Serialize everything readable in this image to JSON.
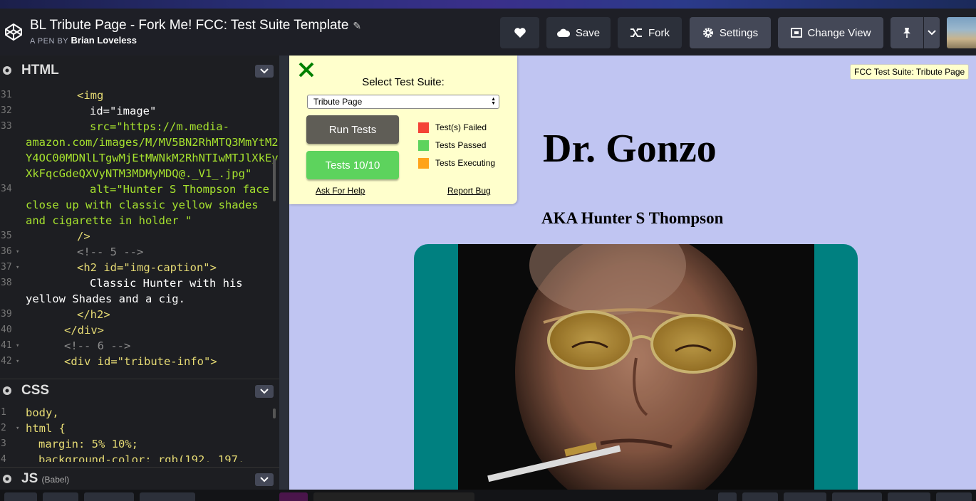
{
  "header": {
    "title": "BL Tribute Page - Fork Me! FCC: Test Suite Template",
    "byline_prefix": "A PEN BY",
    "author": "Brian Loveless",
    "buttons": {
      "save": "Save",
      "fork": "Fork",
      "settings": "Settings",
      "change_view": "Change View"
    }
  },
  "editor": {
    "html_label": "HTML",
    "css_label": "CSS",
    "js_label": "JS",
    "js_sub": "(Babel)",
    "html_lines": [
      {
        "n": "31",
        "text": "<img"
      },
      {
        "n": "32",
        "text": "id=\"image\""
      },
      {
        "n": "33",
        "text": "src=\"https://m.media-"
      },
      {
        "n": "",
        "text": "amazon.com/images/M/MV5BN2RhMTQ3MmYtM2"
      },
      {
        "n": "",
        "text": "Y4OC00MDNlLTgwMjEtMWNkM2RhNTIwMTJlXkEy"
      },
      {
        "n": "",
        "text": "XkFqcGdeQXVyNTM3MDMyMDQ@._V1_.jpg\""
      },
      {
        "n": "34",
        "text": "alt=\"Hunter S Thompson face"
      },
      {
        "n": "",
        "text": "close up with classic yellow shades"
      },
      {
        "n": "",
        "text": "and cigarette in holder \""
      },
      {
        "n": "35",
        "text": "/>"
      },
      {
        "n": "36",
        "text": "<!-- 5 -->"
      },
      {
        "n": "37",
        "text": "<h2 id=\"img-caption\">"
      },
      {
        "n": "38",
        "text": "Classic Hunter with his"
      },
      {
        "n": "",
        "text": "yellow Shades and a cig."
      },
      {
        "n": "39",
        "text": "</h2>"
      },
      {
        "n": "40",
        "text": "</div>"
      },
      {
        "n": "41",
        "text": "<!-- 6 -->"
      },
      {
        "n": "42",
        "text": "<div id=\"tribute-info\">"
      }
    ],
    "css_lines": [
      {
        "n": "1",
        "text": "body,"
      },
      {
        "n": "2",
        "text": "html {"
      },
      {
        "n": "3",
        "text": "margin: 5% 10%;"
      },
      {
        "n": "4",
        "text": "background-color: rgb(192, 197,"
      }
    ]
  },
  "test_suite": {
    "select_label": "Select Test Suite:",
    "selected": "Tribute Page",
    "run_button": "Run Tests",
    "result_button": "Tests 10/10",
    "legend": [
      {
        "label": "Test(s) Failed",
        "color": "#f44336"
      },
      {
        "label": "Tests Passed",
        "color": "#5dd35d"
      },
      {
        "label": "Tests Executing",
        "color": "#ffa31a"
      }
    ],
    "help_link": "Ask For Help",
    "bug_link": "Report Bug"
  },
  "preview": {
    "tooltip": "FCC Test Suite: Tribute Page",
    "heading": "Dr. Gonzo",
    "subheading": "AKA Hunter S Thompson",
    "background": "#c0c5f2",
    "image_frame_color": "#008080"
  }
}
